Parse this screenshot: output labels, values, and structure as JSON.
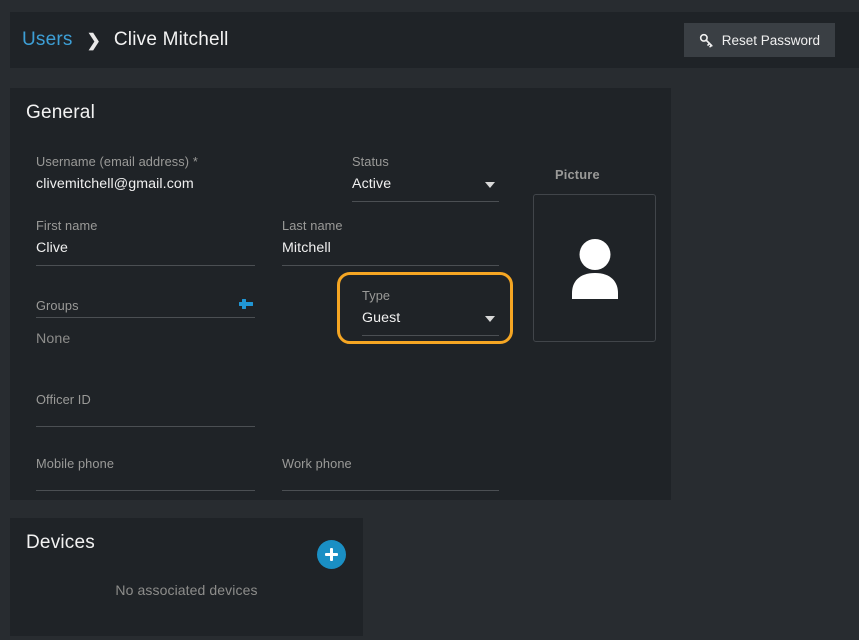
{
  "header": {
    "breadcrumb": {
      "parent": "Users",
      "separator": "❯",
      "current": "Clive Mitchell"
    },
    "reset_password_button": "Reset Password",
    "key_icon_name": "key-icon"
  },
  "general": {
    "title": "General",
    "fields": {
      "username": {
        "label": "Username (email address) *",
        "value": "clivemitchell@gmail.com"
      },
      "status": {
        "label": "Status",
        "value": "Active"
      },
      "first_name": {
        "label": "First name",
        "value": "Clive"
      },
      "last_name": {
        "label": "Last name",
        "value": "Mitchell"
      },
      "groups": {
        "label": "Groups",
        "value": "None",
        "add_icon": "plus-icon"
      },
      "type": {
        "label": "Type",
        "value": "Guest",
        "highlighted": true
      },
      "officer_id": {
        "label": "Officer ID",
        "value": ""
      },
      "mobile_phone": {
        "label": "Mobile phone",
        "value": ""
      },
      "work_phone": {
        "label": "Work phone",
        "value": ""
      }
    },
    "picture": {
      "label": "Picture",
      "placeholder_icon": "person-avatar-icon"
    }
  },
  "devices": {
    "title": "Devices",
    "add_button_icon": "plus-icon",
    "empty_message": "No associated devices"
  },
  "colors": {
    "page_background": "#282c30",
    "card_background": "#1f2327",
    "link_blue": "#3d9fd6",
    "accent_blue": "#1a8fc4",
    "highlight_orange": "#f5a623",
    "label_grey": "#9a9a98",
    "text_white": "#f0f0f0"
  }
}
